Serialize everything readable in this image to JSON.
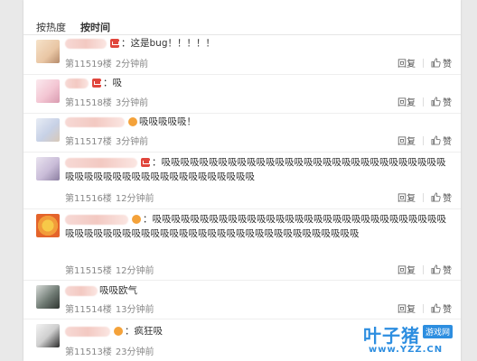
{
  "sort": {
    "hot": "按热度",
    "time": "按时间"
  },
  "actions": {
    "reply": "回复",
    "like": "赞"
  },
  "comments": [
    {
      "text": "：这是bug！！！！！",
      "floor": "第11519楼",
      "time": "2分钟前"
    },
    {
      "text": "：吸",
      "floor": "第11518楼",
      "time": "3分钟前"
    },
    {
      "text": "吸吸吸吸吸！",
      "floor": "第11517楼",
      "time": "3分钟前"
    },
    {
      "text": "：吸吸吸吸吸吸吸吸吸吸吸吸吸吸吸吸吸吸吸吸吸吸吸吸吸吸吸吸吸吸吸吸吸吸吸吸吸吸吸吸吸吸吸吸吸吸吸吸吸吸",
      "floor": "第11516楼",
      "time": "12分钟前"
    },
    {
      "text": "：吸吸吸吸吸吸吸吸吸吸吸吸吸吸吸吸吸吸吸吸吸吸吸吸吸吸吸吸吸吸吸吸吸吸吸吸吸吸吸吸吸吸吸吸吸吸吸吸吸吸吸吸吸吸吸吸吸吸吸吸吸吸",
      "floor": "第11515楼",
      "time": "12分钟前"
    },
    {
      "text": "吸吸欧气",
      "floor": "第11514楼",
      "time": "13分钟前"
    },
    {
      "text": "：疯狂吸",
      "floor": "第11513楼",
      "time": "23分钟前"
    }
  ],
  "watermark": {
    "name": "叶子猪",
    "tag": "游戏网",
    "url": "www.YZZ.CN"
  },
  "colors": {
    "link": "#2d8ee0",
    "badge_red": "#e0463c",
    "badge_gold": "#f4a23a"
  }
}
